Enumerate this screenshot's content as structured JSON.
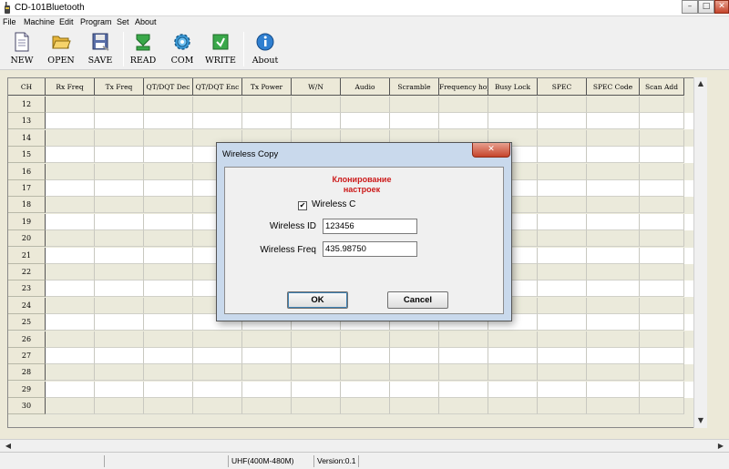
{
  "window": {
    "title": "CD-101Bluetooth",
    "controls": {
      "minimize": "–",
      "maximize": "□",
      "close": "✕"
    }
  },
  "menu": [
    "File",
    "Machine",
    "Edit",
    "Program",
    "Set",
    "About"
  ],
  "toolbar": [
    {
      "label": "NEW",
      "icon": "document-icon"
    },
    {
      "label": "OPEN",
      "icon": "folder-open-icon"
    },
    {
      "label": "SAVE",
      "icon": "floppy-disk-icon"
    },
    {
      "label": "READ",
      "icon": "green-arrow-read-icon"
    },
    {
      "label": "COM",
      "icon": "gear-icon"
    },
    {
      "label": "WRITE",
      "icon": "green-arrow-write-icon"
    },
    {
      "label": "About",
      "icon": "info-icon"
    }
  ],
  "grid": {
    "columns": [
      "CH",
      "Rx Freq",
      "Tx Freq",
      "QT/DQT Dec",
      "QT/DQT Enc",
      "Tx Power",
      "W/N",
      "Audio",
      "Scramble",
      "Frequency hop",
      "Busy Lock",
      "SPEC",
      "SPEC Code",
      "Scan Add"
    ],
    "rows": [
      "12",
      "13",
      "14",
      "15",
      "16",
      "17",
      "18",
      "19",
      "20",
      "21",
      "22",
      "23",
      "24",
      "25",
      "26",
      "27",
      "28",
      "29",
      "30"
    ]
  },
  "status": {
    "band": "UHF(400M-480M)",
    "version": "Version:0.1"
  },
  "dialog": {
    "title": "Wireless Copy",
    "close": "✕",
    "heading_line1": "Клонирование",
    "heading_line2": "настроек",
    "checkbox_label": "Wireless C",
    "checkbox_checked": true,
    "id_label": "Wireless ID",
    "id_value": "123456",
    "freq_label": "Wireless Freq",
    "freq_value": "435.98750",
    "ok": "OK",
    "cancel": "Cancel"
  },
  "colors": {
    "accent_red": "#cc1a1a",
    "dialog_frame": "#c9d9ec",
    "close_button": "#c5442b"
  }
}
